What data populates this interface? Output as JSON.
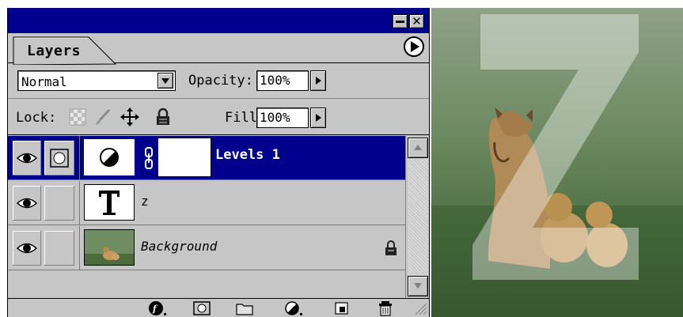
{
  "panel": {
    "tab_label": "Layers",
    "blend_mode": "Normal",
    "opacity_label": "Opacity:",
    "opacity_value": "100%",
    "lock_label": "Lock:",
    "fill_label": "Fill:",
    "fill_value": "100%",
    "close_glyph": "✕"
  },
  "layers": [
    {
      "name": "Levels 1",
      "type": "adjustment",
      "selected": true
    },
    {
      "name": "z",
      "type": "text",
      "selected": false
    },
    {
      "name": "Background",
      "type": "image",
      "selected": false,
      "locked": true
    }
  ],
  "photo": {
    "letter": "Z"
  },
  "colors": {
    "title_bar": "#00008c",
    "selected_row": "#00008c",
    "panel_bg": "#c6c6c6"
  },
  "icons": {
    "lock_transparency": "checker-icon",
    "lock_image": "brush-icon",
    "lock_position": "move-icon",
    "lock_all": "padlock-icon",
    "bottom": [
      "layer-style-icon",
      "add-mask-icon",
      "new-group-icon",
      "adjustment-layer-icon",
      "new-layer-icon",
      "trash-icon"
    ]
  }
}
